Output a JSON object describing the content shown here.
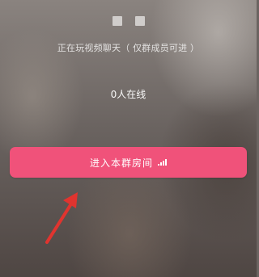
{
  "header": {
    "avatars": [
      "avatar-1",
      "avatar-2"
    ]
  },
  "status_text": "正在玩视频聊天（ 仅群成员可进 ）",
  "online_count_text": "0人在线",
  "enter_button": {
    "label": "进入本群房间",
    "icon": "signal-bars-icon"
  },
  "annotation": {
    "arrow_color": "#e0342f"
  },
  "colors": {
    "button": "#f0527a"
  }
}
